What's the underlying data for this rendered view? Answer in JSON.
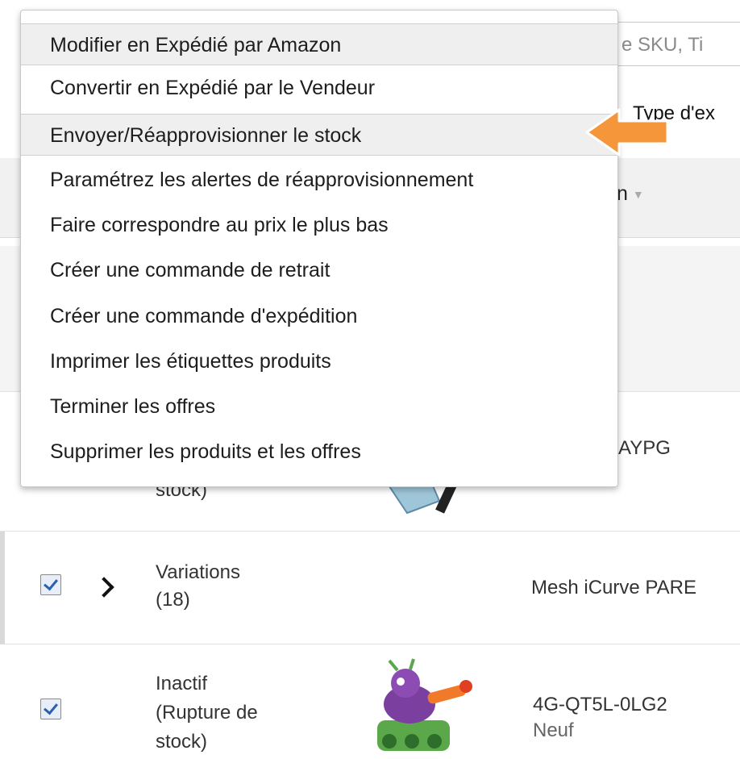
{
  "search": {
    "placeholder_visible": "e SKU, Ti"
  },
  "filters": {
    "type_label": "Type d'ex"
  },
  "table": {
    "column_header": "n"
  },
  "menu": {
    "items": [
      "Modifier en Expédié par Amazon",
      "Convertir en Expédié par le Vendeur",
      "Envoyer/Réapprovisionner le stock",
      "Paramétrez les alertes de réapprovisionnement",
      "Faire correspondre au prix le plus bas",
      "Créer une commande de retrait",
      "Créer une commande d'expédition",
      "Imprimer les étiquettes produits",
      "Terminer les offres",
      "Supprimer les produits et les offres"
    ]
  },
  "rows": [
    {
      "status_partial": "stock)",
      "sku_partial": "AYPG"
    },
    {
      "status_line1": "Variations",
      "status_line2": "(18)",
      "title_partial": "Mesh iCurve PARE"
    },
    {
      "status_line1": "Inactif",
      "status_line2": "(Rupture de",
      "status_line3": "stock)",
      "sku": "4G-QT5L-0LG2",
      "condition": "Neuf"
    }
  ],
  "colors": {
    "arrow_fill": "#f5963a",
    "arrow_stroke": "#ffffff",
    "checkbox_check": "#2b5fb0"
  },
  "icons": {
    "arrow": "orange-left-arrow-icon",
    "expand": "chevron-right-icon",
    "check": "checkbox-checked-icon"
  }
}
